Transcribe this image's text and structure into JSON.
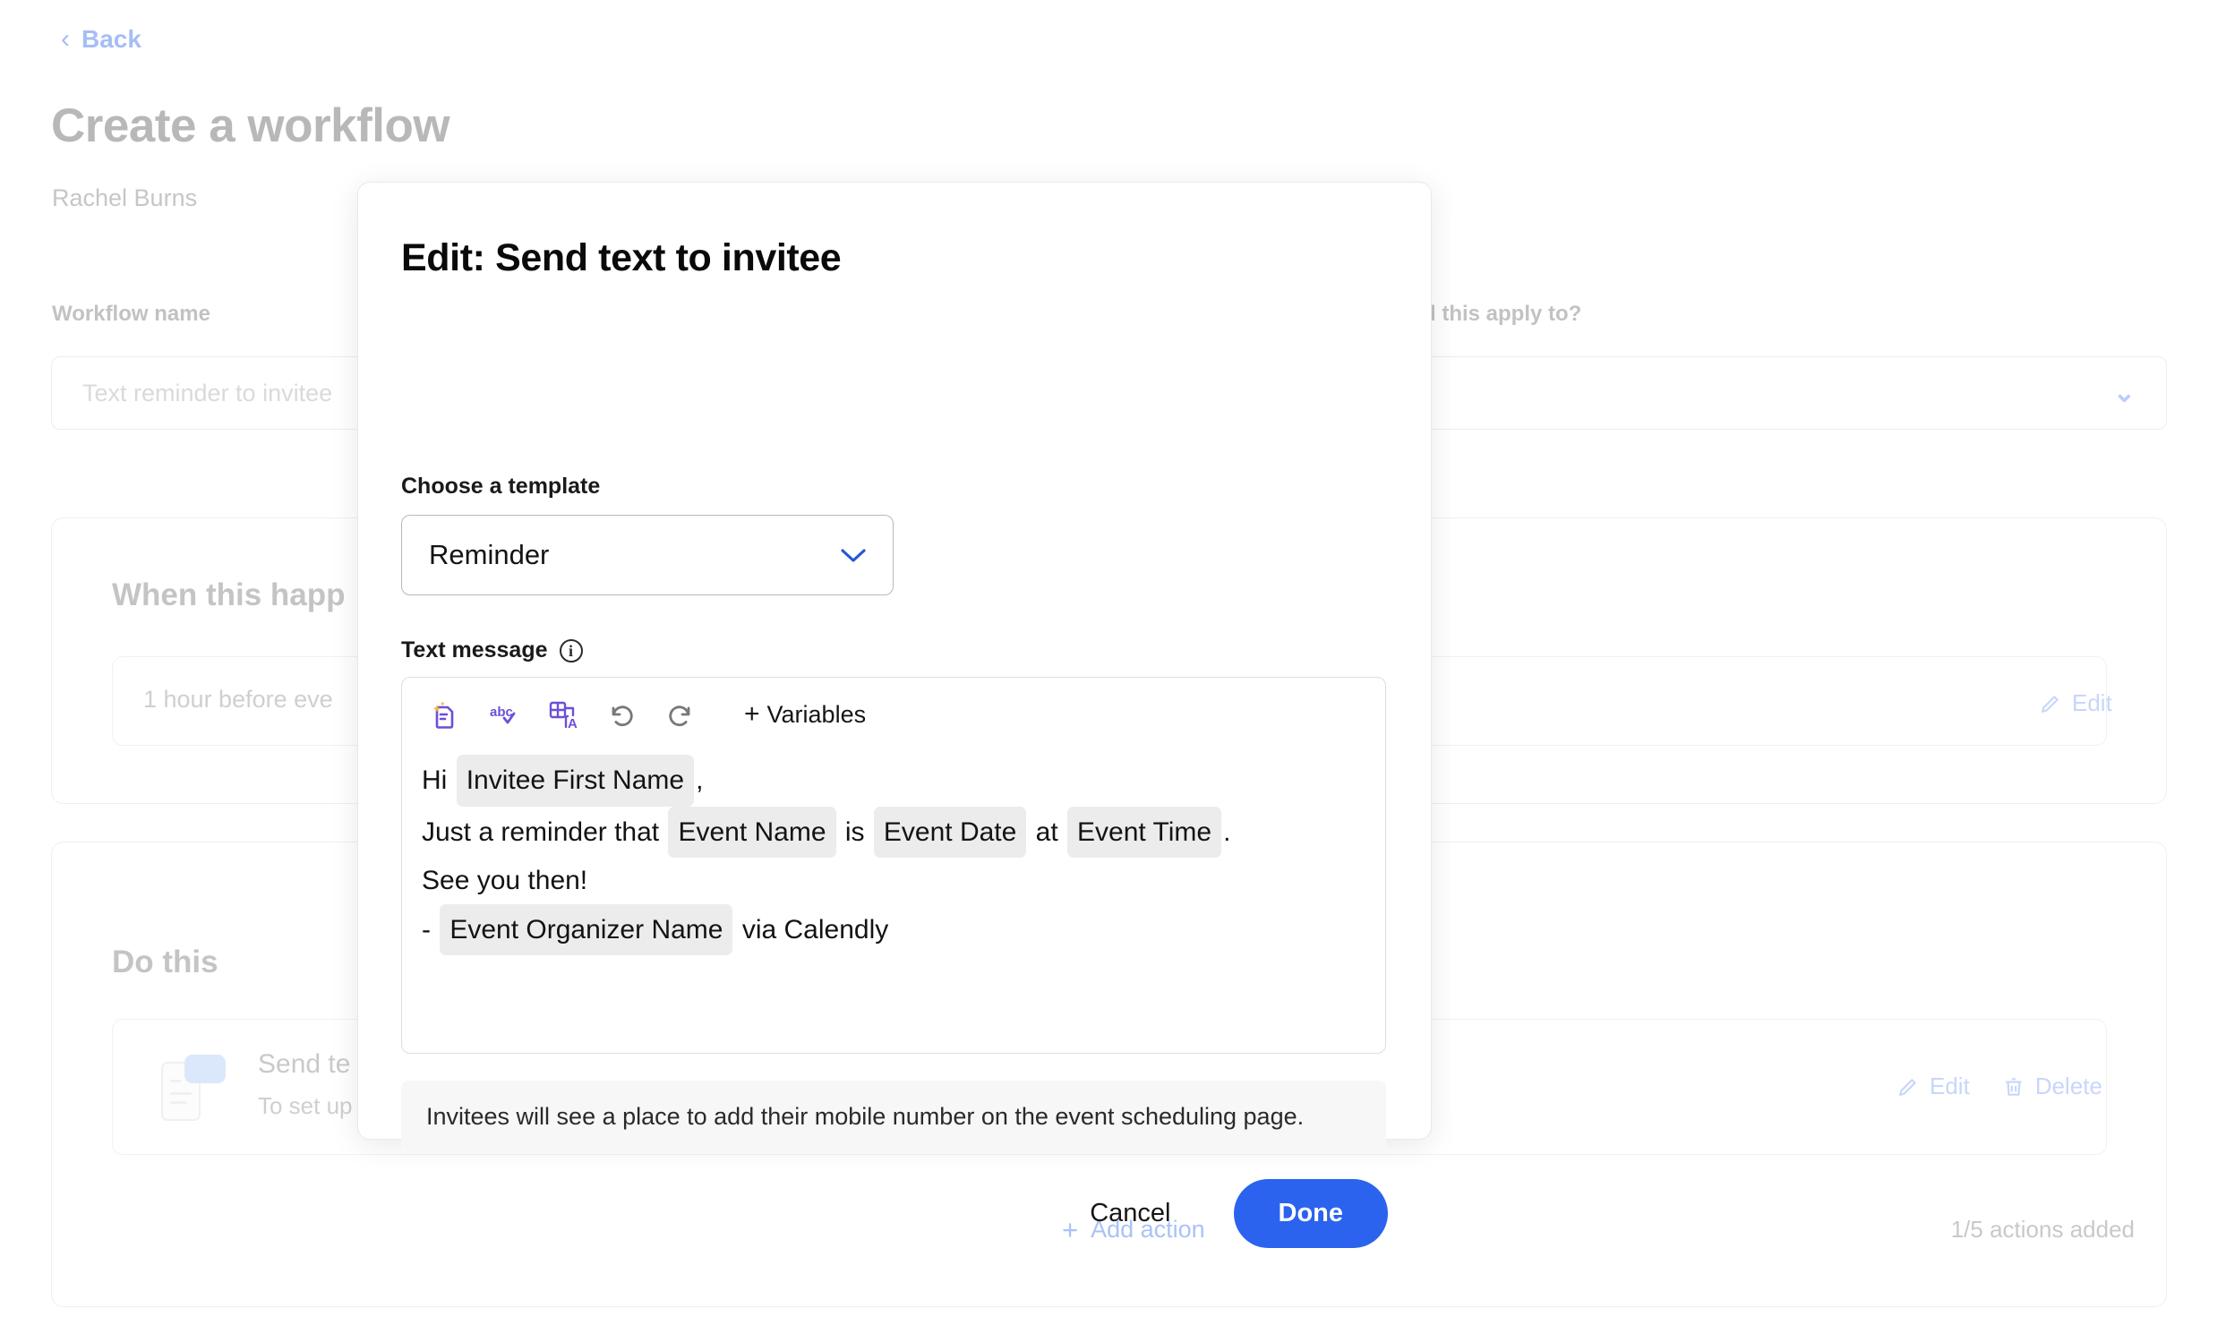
{
  "background": {
    "back_label": "Back",
    "page_title": "Create a workflow",
    "owner_name": "Rachel Burns",
    "workflow_name_label": "Workflow name",
    "workflow_name_value": "Text reminder to invitee",
    "apply_to_label": "l this apply to?",
    "when_section_title": "When this happ",
    "trigger_text": "1 hour before eve",
    "trigger_edit_label": "Edit",
    "do_section_title": "Do this",
    "action_title": "Send te",
    "action_subtitle": "To set up",
    "action_edit_label": "Edit",
    "action_delete_label": "Delete",
    "add_action_label": "Add action",
    "actions_count": "1/5 actions added"
  },
  "modal": {
    "title": "Edit: Send text to invitee",
    "template_label": "Choose a template",
    "template_selected": "Reminder",
    "text_message_label": "Text message",
    "info_glyph": "i",
    "toolbar": {
      "variables_label": "Variables",
      "plus": "+",
      "buttons": [
        {
          "name": "ai-write-icon",
          "title": "AI write"
        },
        {
          "name": "spellcheck-icon",
          "title": "Spell check"
        },
        {
          "name": "translate-icon",
          "title": "Translate"
        },
        {
          "name": "undo-icon",
          "title": "Undo"
        },
        {
          "name": "redo-icon",
          "title": "Redo"
        }
      ]
    },
    "message": {
      "line1_prefix": "Hi",
      "line1_chip": "Invitee First Name",
      "line1_suffix": ",",
      "line2_prefix": "Just a reminder that",
      "line2_chip1": "Event Name",
      "line2_mid1": "is",
      "line2_chip2": "Event Date",
      "line2_mid2": "at",
      "line2_chip3": "Event Time",
      "line2_suffix": ".",
      "line3": "See you then!",
      "line4_prefix": "-",
      "line4_chip": "Event Organizer Name",
      "line4_suffix": "via Calendly"
    },
    "notice": "Invitees will see a place to add their mobile number on the event scheduling page.",
    "cancel_label": "Cancel",
    "done_label": "Done"
  },
  "colors": {
    "primary_blue": "#2b63ef",
    "link_blue": "#a6bdf5",
    "select_chevron": "#2757d6",
    "purple_icon": "#6d4fd8",
    "chip_gray": "#ececec"
  }
}
